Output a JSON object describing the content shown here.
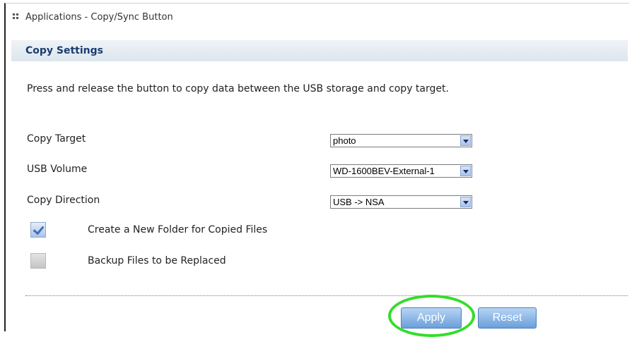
{
  "window": {
    "title": "Applications - Copy/Sync Button"
  },
  "section": {
    "title": "Copy Settings"
  },
  "description": "Press and release the button to copy data between the USB storage and copy target.",
  "fields": {
    "copy_target": {
      "label": "Copy Target",
      "value": "photo"
    },
    "usb_volume": {
      "label": "USB Volume",
      "value": "WD-1600BEV-External-1"
    },
    "copy_direction": {
      "label": "Copy Direction",
      "value": "USB -> NSA"
    }
  },
  "checkboxes": {
    "new_folder": {
      "label": "Create a New Folder for Copied Files",
      "checked": true
    },
    "backup": {
      "label": "Backup Files to be Replaced",
      "checked": false
    }
  },
  "buttons": {
    "apply": "Apply",
    "reset": "Reset"
  },
  "colors": {
    "section_title": "#1a3d6e",
    "button": "#6a9fdb",
    "highlight_ring": "#33dd2b"
  }
}
